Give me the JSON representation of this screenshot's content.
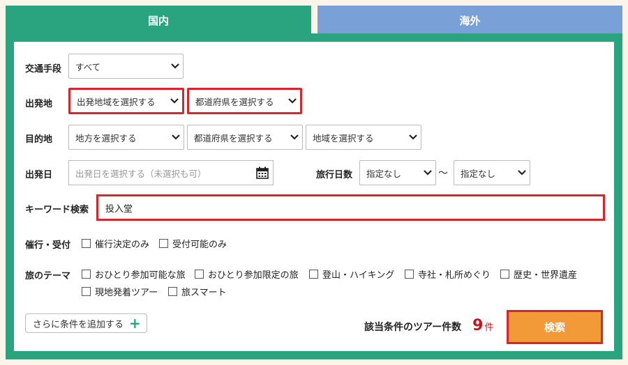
{
  "tabs": {
    "domestic": "国内",
    "overseas": "海外"
  },
  "transport": {
    "label": "交通手段",
    "value": "すべて"
  },
  "departure": {
    "label": "出発地",
    "region": "出発地域を選択する",
    "prefecture": "都道府県を選択する"
  },
  "destination": {
    "label": "目的地",
    "area": "地方を選択する",
    "prefecture": "都道府県を選択する",
    "region": "地域を選択する"
  },
  "departure_date": {
    "label": "出発日",
    "placeholder": "出発日を選択する（未選択も可）"
  },
  "travel_days": {
    "label": "旅行日数",
    "from": "指定なし",
    "separator": "〜",
    "to": "指定なし"
  },
  "keyword": {
    "label": "キーワード検索",
    "value": "投入堂"
  },
  "guarantee": {
    "label": "催行・受付",
    "options": [
      "催行決定のみ",
      "受付可能のみ"
    ]
  },
  "theme": {
    "label": "旅のテーマ",
    "options": [
      "おひとり参加可能な旅",
      "おひとり参加限定の旅",
      "登山・ハイキング",
      "寺社・札所めぐり",
      "歴史・世界遺産",
      "現地発着ツアー",
      "旅スマート"
    ]
  },
  "add_conditions": "さらに条件を追加する",
  "result": {
    "label": "該当条件のツアー件数",
    "count": "9",
    "unit": "件"
  },
  "search_button": "検索",
  "colors": {
    "accent_green": "#2aa37f",
    "overseas_blue": "#7aa0d8",
    "search_orange": "#f29a37",
    "highlight_red": "#d6262c"
  }
}
